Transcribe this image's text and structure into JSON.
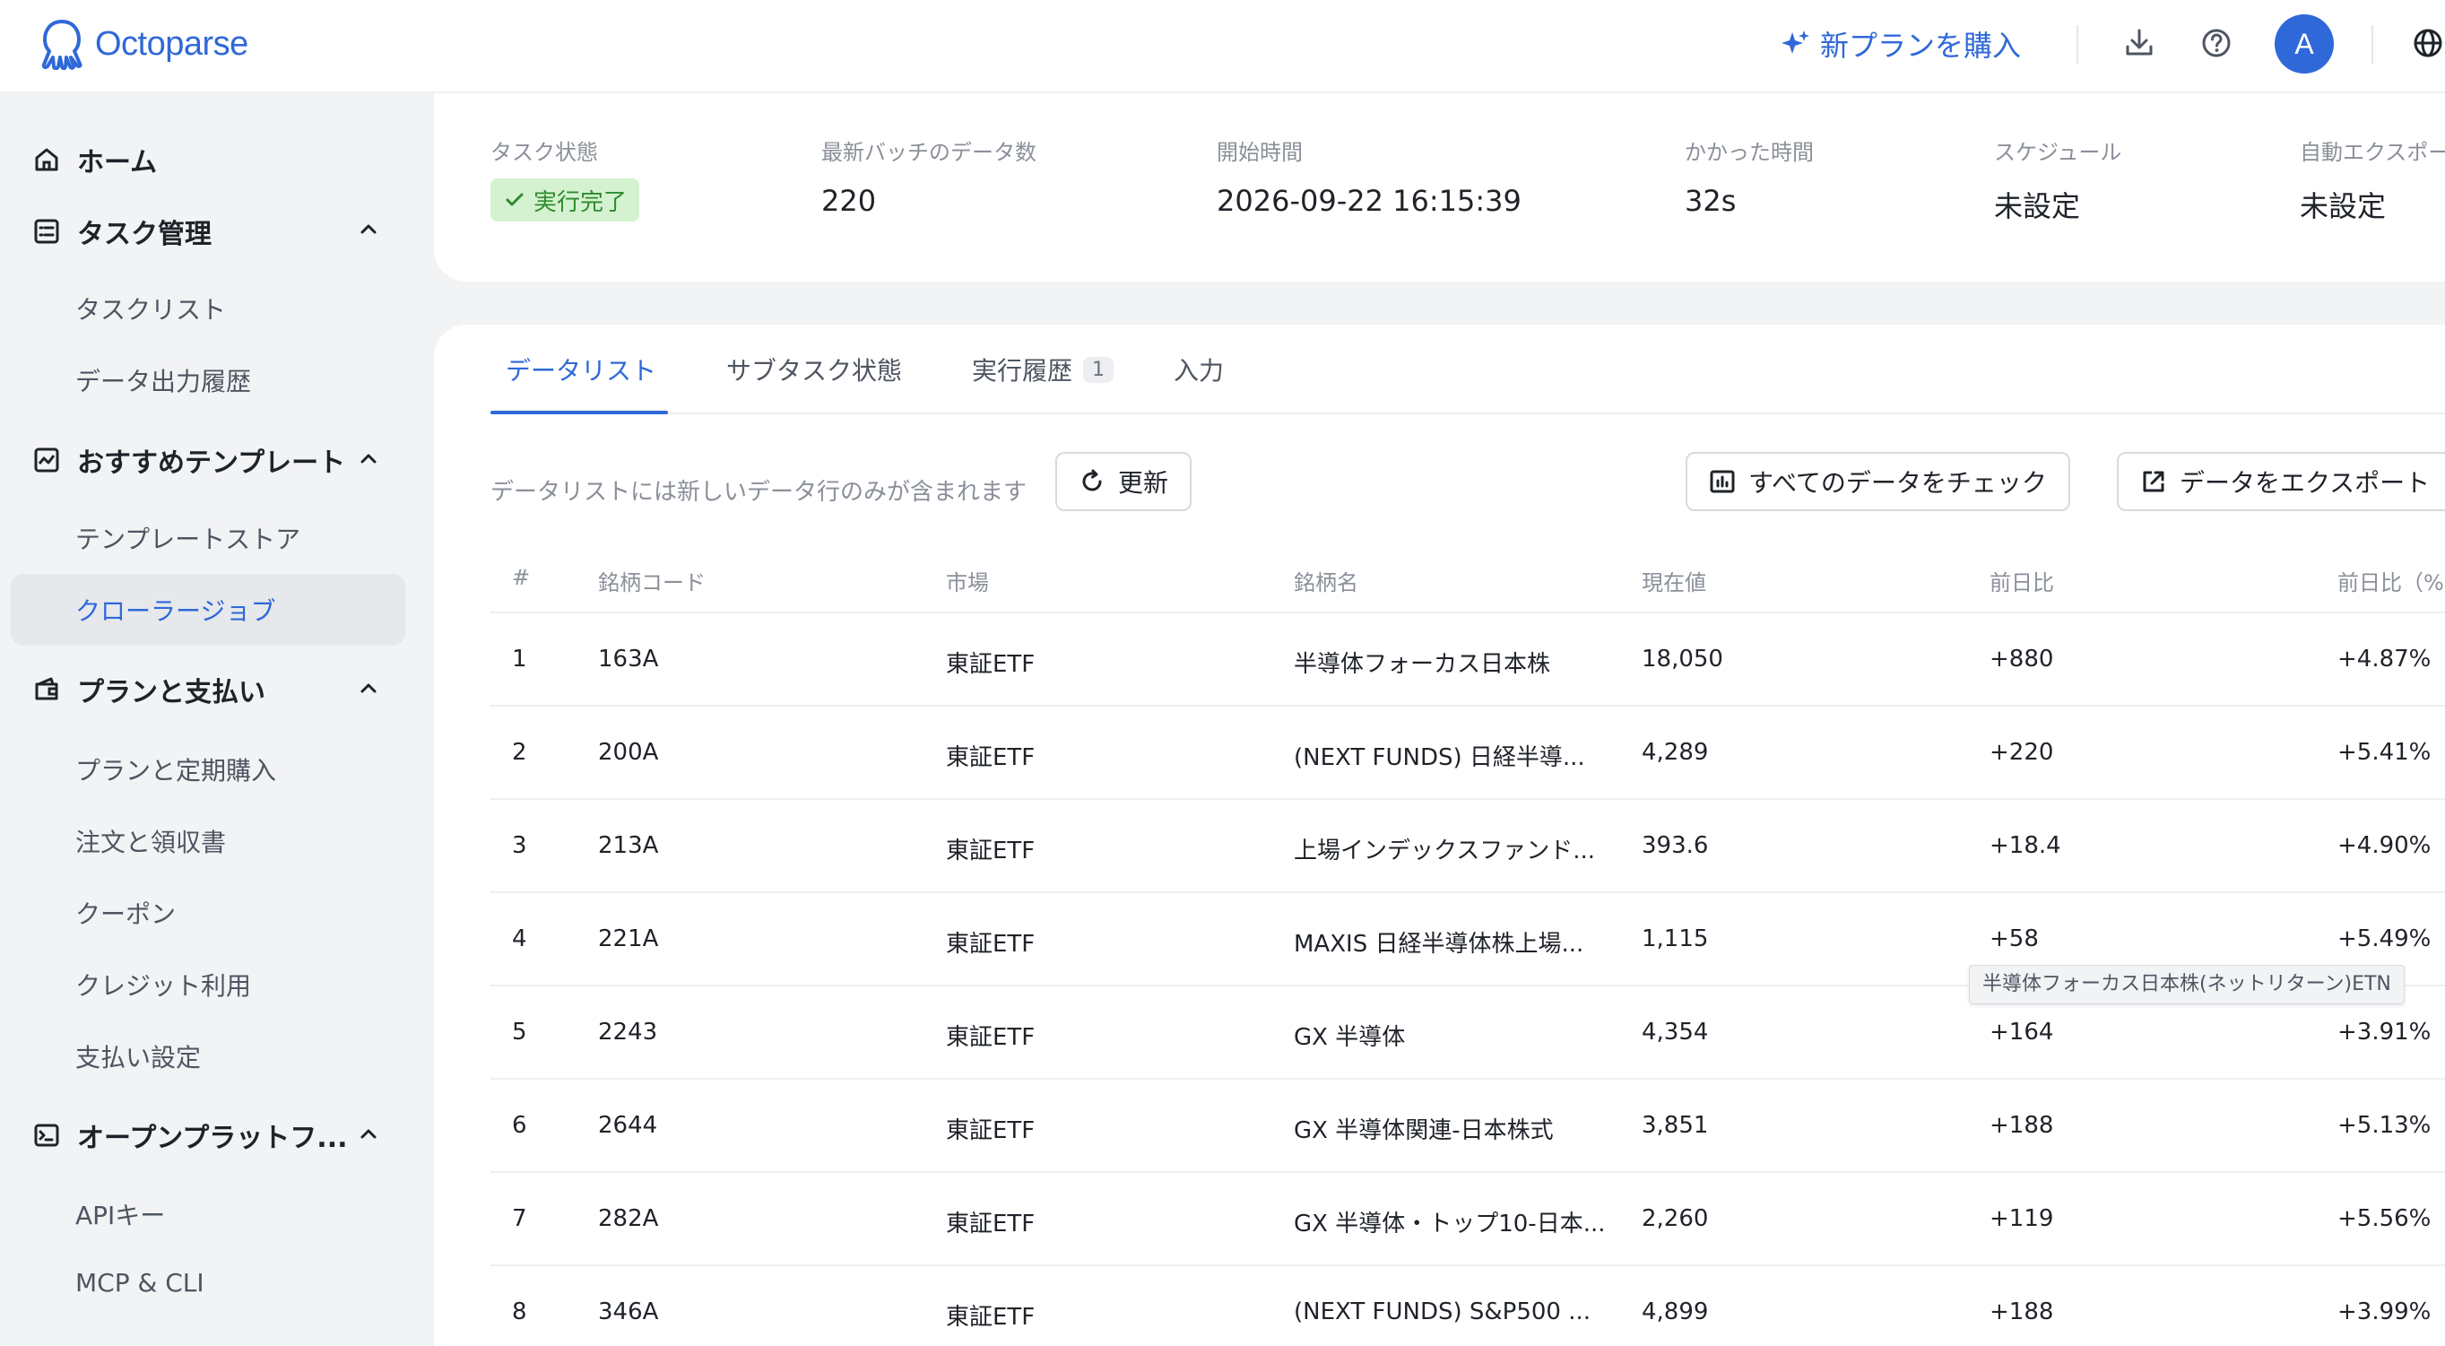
{
  "header": {
    "logo_text": "Octoparse",
    "buy_plan_label": "新プランを購入",
    "avatar_letter": "A",
    "brand_color": "#2f68d8"
  },
  "sidebar": {
    "home_label": "ホーム",
    "task_mgmt_label": "タスク管理",
    "task_list_label": "タスクリスト",
    "export_history_label": "データ出力履歴",
    "templates_label": "おすすめテンプレート",
    "template_store_label": "テンプレートストア",
    "crawler_jobs_label": "クローラージョブ",
    "billing_label": "プランと支払い",
    "plan_subscription_label": "プランと定期購入",
    "orders_label": "注文と領収書",
    "coupon_label": "クーポン",
    "credit_usage_label": "クレジット利用",
    "payment_settings_label": "支払い設定",
    "open_platform_label": "オープンプラットフ...",
    "api_key_label": "APIキー",
    "mcp_cli_label": "MCP & CLI"
  },
  "status": {
    "task_status_label": "タスク状態",
    "task_status_value": "実行完了",
    "latest_batch_label": "最新バッチのデータ数",
    "latest_batch_value": "220",
    "start_time_label": "開始時間",
    "start_time_value": "2026-09-22 16:15:39",
    "duration_label": "かかった時間",
    "duration_value": "32s",
    "schedule_label": "スケジュール",
    "schedule_value": "未設定",
    "auto_export_label": "自動エクスポー",
    "auto_export_value": "未設定"
  },
  "tabs": {
    "data_list": "データリスト",
    "subtask_status": "サブタスク状態",
    "run_history": "実行履歴",
    "run_history_count": "1",
    "input": "入力"
  },
  "toolbar": {
    "note": "データリストには新しいデータ行のみが含まれます",
    "refresh_label": "更新",
    "check_all_label": "すべてのデータをチェック",
    "export_label": "データをエクスポート"
  },
  "table": {
    "columns": [
      "#",
      "銘柄コード",
      "市場",
      "銘柄名",
      "現在値",
      "前日比",
      "前日比（%"
    ],
    "rows": [
      [
        "1",
        "163A",
        "東証ETF",
        "半導体フォーカス日本株",
        "18,050",
        "+880",
        "+4.87%"
      ],
      [
        "2",
        "200A",
        "東証ETF",
        "(NEXT FUNDS) 日経半導...",
        "4,289",
        "+220",
        "+5.41%"
      ],
      [
        "3",
        "213A",
        "東証ETF",
        "上場インデックスファンド...",
        "393.6",
        "+18.4",
        "+4.90%"
      ],
      [
        "4",
        "221A",
        "東証ETF",
        "MAXIS 日経半導体株上場...",
        "1,115",
        "+58",
        "+5.49%"
      ],
      [
        "5",
        "2243",
        "東証ETF",
        "GX 半導体",
        "4,354",
        "+164",
        "+3.91%"
      ],
      [
        "6",
        "2644",
        "東証ETF",
        "GX 半導体関連-日本株式",
        "3,851",
        "+188",
        "+5.13%"
      ],
      [
        "7",
        "282A",
        "東証ETF",
        "GX 半導体・トップ10-日本...",
        "2,260",
        "+119",
        "+5.56%"
      ],
      [
        "8",
        "346A",
        "東証ETF",
        "(NEXT FUNDS) S&P500 ...",
        "4,899",
        "+188",
        "+3.99%"
      ]
    ],
    "tooltip": "半導体フォーカス日本株(ネットリターン)ETN"
  }
}
